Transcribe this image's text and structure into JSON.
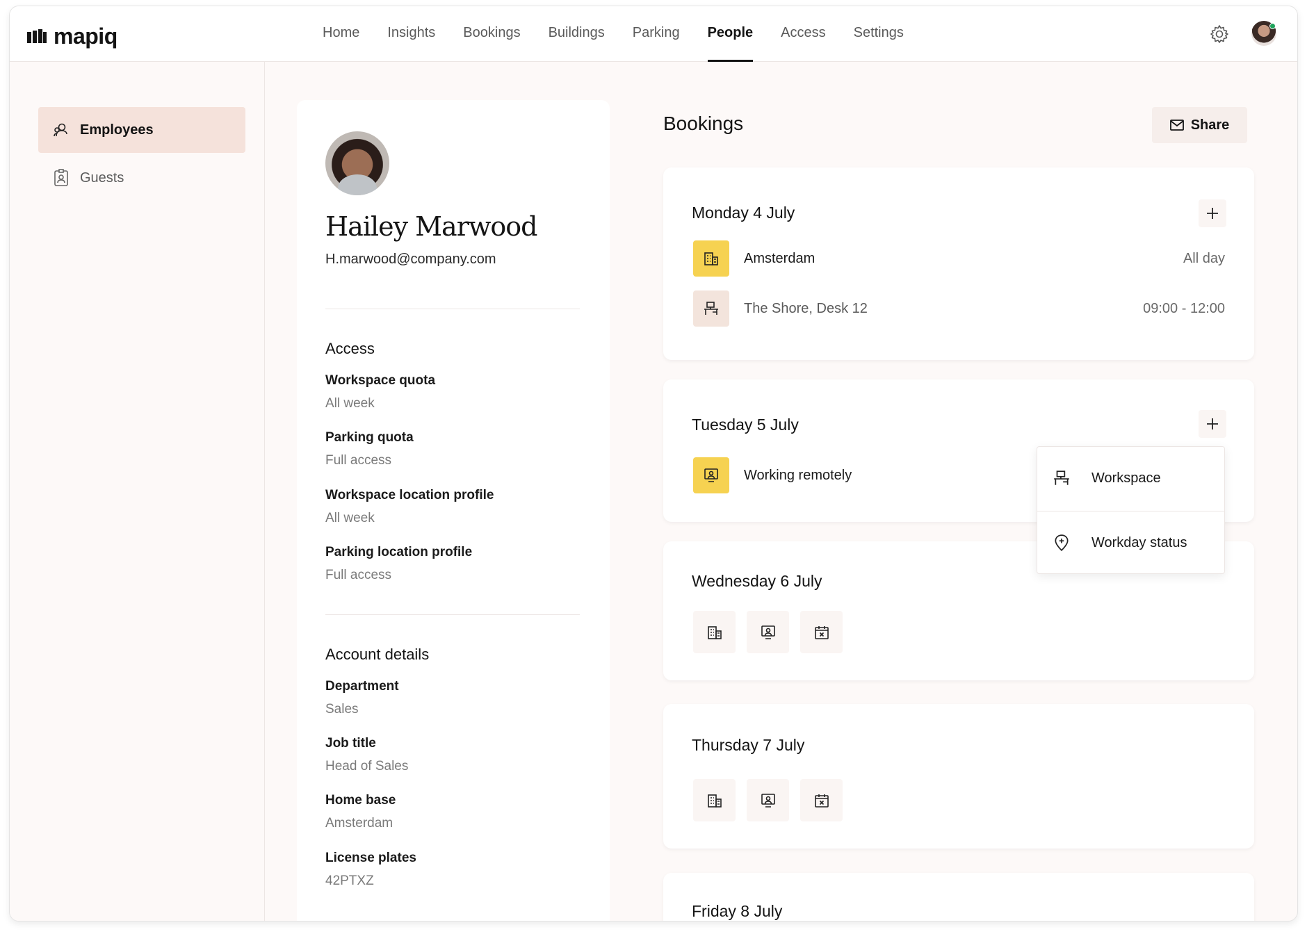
{
  "app": {
    "brand": "mapiq"
  },
  "nav": {
    "items": [
      {
        "label": "Home"
      },
      {
        "label": "Insights"
      },
      {
        "label": "Bookings"
      },
      {
        "label": "Buildings"
      },
      {
        "label": "Parking"
      },
      {
        "label": "People",
        "active": true
      },
      {
        "label": "Access"
      },
      {
        "label": "Settings"
      }
    ]
  },
  "sidebar": {
    "items": [
      {
        "label": "Employees",
        "icon": "people-icon",
        "active": true
      },
      {
        "label": "Guests",
        "icon": "badge-icon"
      }
    ]
  },
  "profile": {
    "name": "Hailey Marwood",
    "email": "H.marwood@company.com",
    "access": {
      "title": "Access",
      "fields": [
        {
          "label": "Workspace quota",
          "value": "All week"
        },
        {
          "label": "Parking quota",
          "value": "Full access"
        },
        {
          "label": "Workspace location profile",
          "value": "All week"
        },
        {
          "label": "Parking location profile",
          "value": "Full access"
        }
      ]
    },
    "account": {
      "title": "Account details",
      "fields": [
        {
          "label": "Department",
          "value": "Sales"
        },
        {
          "label": "Job title",
          "value": "Head of Sales"
        },
        {
          "label": "Home base",
          "value": "Amsterdam"
        },
        {
          "label": "License plates",
          "value": "42PTXZ"
        }
      ]
    }
  },
  "bookings": {
    "title": "Bookings",
    "share_label": "Share",
    "days": [
      {
        "title": "Monday 4 July",
        "rows": [
          {
            "label": "Amsterdam",
            "time": "All day",
            "icon": "building-icon"
          },
          {
            "label": "The Shore, Desk 12",
            "time": "09:00 - 12:00",
            "icon": "desk-icon"
          }
        ]
      },
      {
        "title": "Tuesday 5 July",
        "rows": [
          {
            "label": "Working remotely",
            "icon": "remote-icon"
          }
        ]
      },
      {
        "title": "Wednesday 6 July"
      },
      {
        "title": "Thursday 7 July"
      },
      {
        "title": "Friday 8 July"
      }
    ]
  },
  "dropdown": {
    "items": [
      {
        "label": "Workspace",
        "icon": "desk-icon"
      },
      {
        "label": "Workday status",
        "icon": "location-pin-icon"
      }
    ]
  },
  "colors": {
    "accent_yellow": "#f6d251",
    "active_sidebar": "#f5e2db",
    "online": "#1fa35c"
  }
}
